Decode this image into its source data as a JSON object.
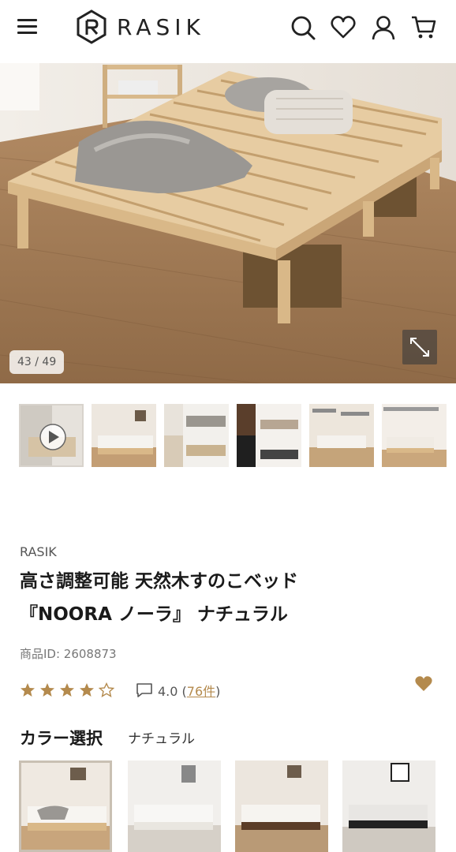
{
  "header": {
    "logo_text": "RASIK",
    "icons": [
      "menu-icon",
      "search-icon",
      "heart-icon",
      "user-icon",
      "cart-icon"
    ]
  },
  "gallery": {
    "counter": "43 / 49",
    "thumbnails": [
      "video-thumb",
      "bed-room-1",
      "bed-comparison",
      "color-variants",
      "bed-with-labels",
      "height-adjust"
    ]
  },
  "product": {
    "brand": "RASIK",
    "title_line1": "高さ調整可能 天然木すのこベッド",
    "title_line2": "『NOORA ノーラ』 ナチュラル",
    "product_id": "商品ID: 2608873",
    "rating_value": "4.0",
    "rating_open": "(",
    "rating_count": "76件",
    "rating_close": ")",
    "stars": 4
  },
  "color_selection": {
    "title": "カラー選択",
    "selected": "ナチュラル",
    "swatches": [
      "natural",
      "white-gray",
      "brown",
      "black"
    ]
  },
  "colors": {
    "accent": "#b48a4d",
    "text": "#1a1a1a",
    "muted": "#777777"
  }
}
